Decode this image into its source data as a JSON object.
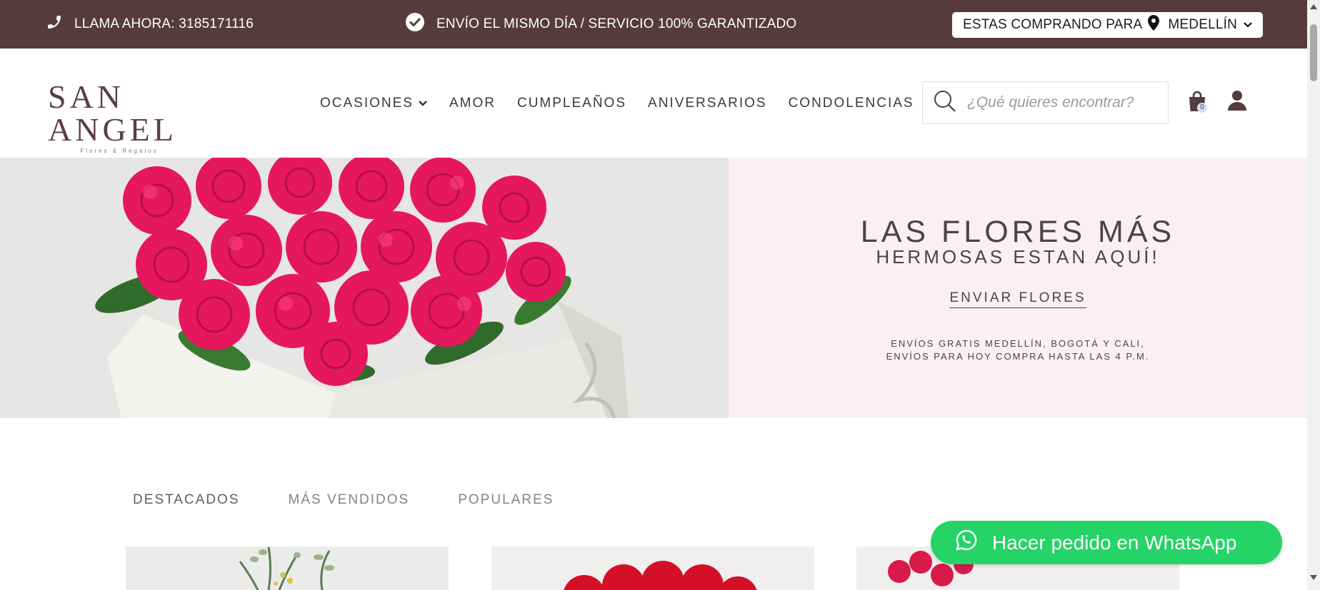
{
  "topbar": {
    "call_text": "LLAMA AHORA: 3185171116",
    "shipping_text": "ENVÍO EL MISMO DÍA / SERVICIO 100% GARANTIZADO",
    "location_prefix": "ESTAS COMPRANDO PARA",
    "location_city": "MEDELLÍN",
    "icons": [
      "phone-icon",
      "check-circle-icon",
      "map-pin-icon",
      "chevron-down-icon"
    ]
  },
  "header": {
    "logo_main": "SAN ANGEL",
    "logo_sub": "Flores & Regalos",
    "nav": [
      {
        "label": "OCASIONES",
        "has_dropdown": true
      },
      {
        "label": "AMOR"
      },
      {
        "label": "CUMPLEAÑOS"
      },
      {
        "label": "ANIVERSARIOS"
      },
      {
        "label": "CONDOLENCIAS"
      }
    ],
    "search_placeholder": "¿Qué quieres encontrar?",
    "cart_count": "0"
  },
  "hero": {
    "title_line1": "LAS FLORES MÁS",
    "title_line2": "HERMOSAS ESTAN AQUÍ!",
    "cta": "ENVIAR FLORES",
    "note_line1": "ENVÍOS GRATIS MEDELLÍN, BOGOTÁ Y CALI,",
    "note_line2": "ENVÍOS PARA HOY COMPRA HASTA LAS 4 P.M."
  },
  "tabs": [
    {
      "label": "DESTACADOS",
      "active": true
    },
    {
      "label": "MÁS VENDIDOS",
      "active": false
    },
    {
      "label": "POPULARES",
      "active": false
    }
  ],
  "whatsapp": {
    "label": "Hacer pedido en WhatsApp"
  },
  "colors": {
    "brand": "#553b3d",
    "whatsapp": "#25d366",
    "hero_bg": "#fbf0f1",
    "rose": "#e5175f"
  }
}
